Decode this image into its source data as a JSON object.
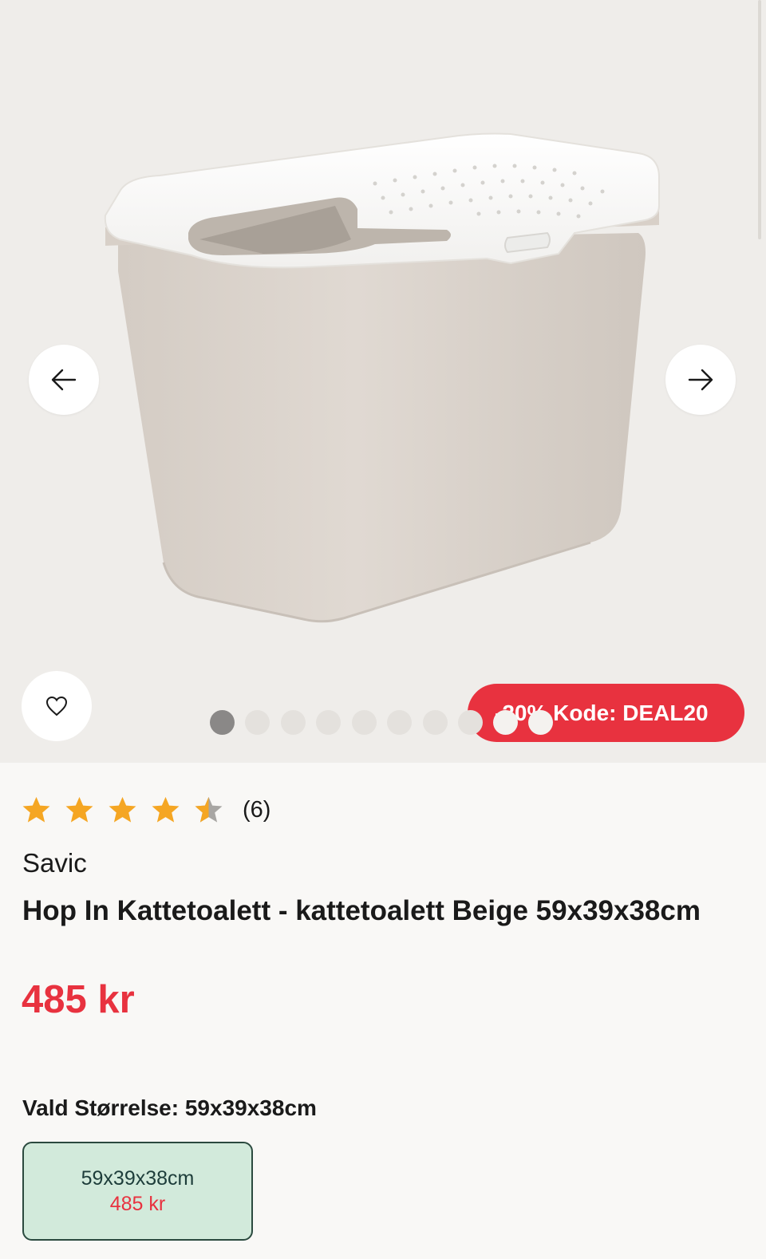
{
  "gallery": {
    "product_image_alt": "",
    "prev_icon": "arrow-left-icon",
    "next_icon": "arrow-right-icon",
    "favorite_icon": "heart-outline-icon",
    "promo_label": "-20% Kode: DEAL20",
    "image_count": 10,
    "active_image": 1
  },
  "rating": {
    "stars": 4.5,
    "max_stars": 5,
    "count": "(6)",
    "star_color": "#f5a623"
  },
  "product": {
    "brand": "Savic",
    "title": "Hop In Kattetoalett - kattetoalett Beige 59x39x38cm",
    "price": "485 kr"
  },
  "size_selector": {
    "heading": "Vald Størrelse: 59x39x38cm",
    "options": [
      {
        "label": "59x39x38cm",
        "price": "485 kr",
        "selected": true
      }
    ]
  },
  "colors": {
    "accent": "#e8323f",
    "selected_option_bg": "#d2eadb",
    "selected_option_border": "#2b4a3f"
  }
}
